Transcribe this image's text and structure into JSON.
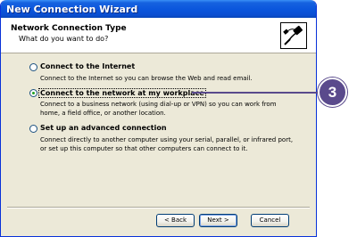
{
  "window": {
    "title": "New Connection Wizard"
  },
  "header": {
    "title": "Network Connection Type",
    "subtitle": "What do you want to do?",
    "icon": "network-connection-icon"
  },
  "options": [
    {
      "label": "Connect to the Internet",
      "description": "Connect to the Internet so you can browse the Web and read email.",
      "selected": false
    },
    {
      "label": "Connect to the network at my workplace",
      "description": "Connect to a business network (using dial-up or VPN) so you can work from home, a field office, or another location.",
      "selected": true
    },
    {
      "label": "Set up an advanced connection",
      "description": "Connect directly to another computer using your serial, parallel, or infrared port, or set up this computer so that other computers can connect to it.",
      "selected": false
    }
  ],
  "buttons": {
    "back": "< Back",
    "next": "Next >",
    "cancel": "Cancel"
  },
  "callout": {
    "number": "3",
    "color": "#5a4a8c"
  },
  "colors": {
    "titlebar": "#0a55dc",
    "dialog_bg": "#ece9d8",
    "radio_dot": "#21a121"
  }
}
